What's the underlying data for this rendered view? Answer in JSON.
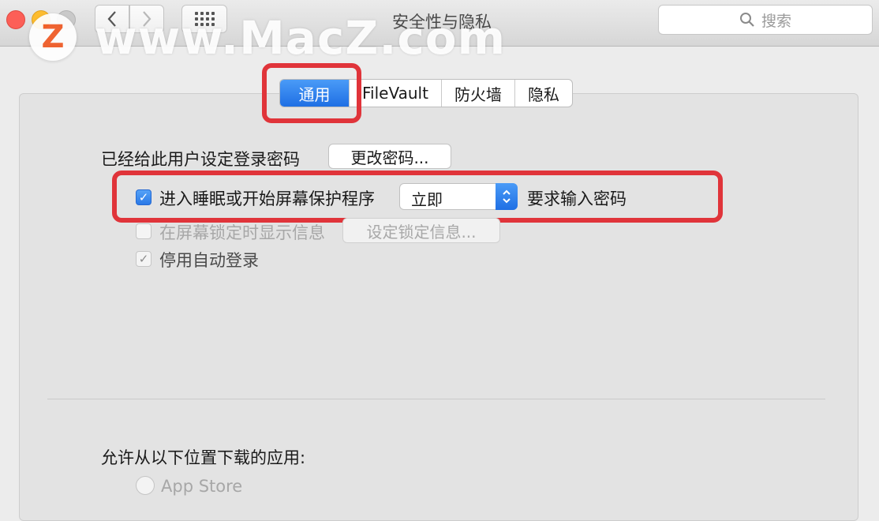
{
  "window": {
    "title": "安全性与隐私",
    "search_placeholder": "搜索"
  },
  "watermark": {
    "logo_letter": "Z",
    "text": "www.MacZ.com"
  },
  "tabs": [
    {
      "label": "通用",
      "active": true
    },
    {
      "label": "FileVault",
      "active": false
    },
    {
      "label": "防火墙",
      "active": false
    },
    {
      "label": "隐私",
      "active": false
    }
  ],
  "general": {
    "password_set_label": "已经给此用户设定登录密码",
    "change_password_button": "更改密码...",
    "require_password": {
      "checked": true,
      "label": "进入睡眠或开始屏幕保护程序",
      "delay_value": "立即",
      "suffix": "要求输入密码"
    },
    "show_message": {
      "checked": false,
      "label": "在屏幕锁定时显示信息",
      "button": "设定锁定信息..."
    },
    "disable_auto_login": {
      "checked": true,
      "label": "停用自动登录"
    }
  },
  "downloads": {
    "heading": "允许从以下位置下载的应用:",
    "options": [
      {
        "label": "App Store",
        "selected": false
      }
    ]
  },
  "colors": {
    "accent": "#1f6fe4",
    "highlight": "#e0343a"
  }
}
